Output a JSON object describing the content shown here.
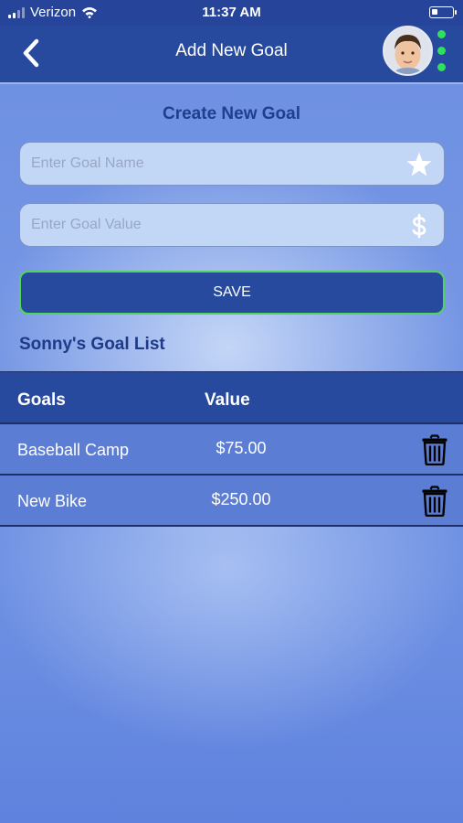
{
  "status_bar": {
    "carrier": "Verizon",
    "time": "11:37 AM"
  },
  "header": {
    "title": "Add New Goal"
  },
  "form": {
    "section_title": "Create New Goal",
    "goal_name_placeholder": "Enter Goal Name",
    "goal_value_placeholder": "Enter Goal Value",
    "save_label": "SAVE"
  },
  "goal_list": {
    "title": "Sonny's Goal List",
    "columns": [
      "Goals",
      "Value"
    ],
    "rows": [
      {
        "name": "Baseball Camp",
        "value": "$75.00"
      },
      {
        "name": "New Bike",
        "value": "$250.00"
      }
    ]
  },
  "icons": {
    "back": "chevron-left-icon",
    "menu": "vertical-dots-icon",
    "goal_name": "star-icon",
    "goal_value": "dollar-icon",
    "delete": "trash-icon"
  },
  "colors": {
    "header_bg": "#284a9e",
    "menu_dots": "#2fe05a",
    "save_border": "#50d55c"
  }
}
